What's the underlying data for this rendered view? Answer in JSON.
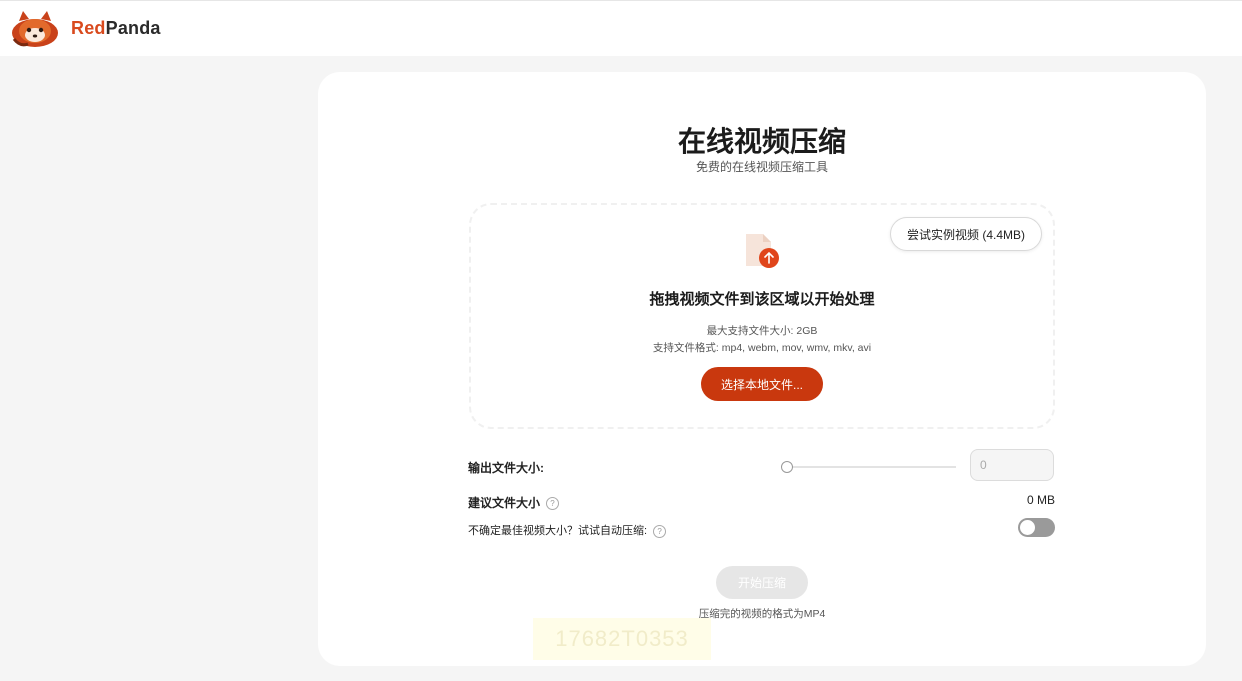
{
  "header": {
    "brand_part1": "Red",
    "brand_part2": "Panda",
    "brand_color": "#d94a1e",
    "logo_icon": "red-panda-logo-icon"
  },
  "main": {
    "title": "在线视频压缩",
    "subtitle": "免费的在线视频压缩工具",
    "try_sample_label": "尝试实例视频 (4.4MB)",
    "drop_title": "拖拽视频文件到该区域以开始处理",
    "max_size_text": "最大支持文件大小: 2GB",
    "formats_text": "支持文件格式: mp4, webm, mov, wmv, mkv, avi",
    "choose_file_label": "选择本地文件...",
    "upload_icon": "file-upload-icon",
    "accent_color": "#c9380e"
  },
  "settings": {
    "output_size_label": "输出文件大小:",
    "output_size_value": "0",
    "slider_value": 0,
    "suggest_label": "建议文件大小",
    "suggest_value": "0 MB",
    "auto_label": "不确定最佳视频大小？试试自动压缩:",
    "auto_enabled": false
  },
  "actions": {
    "start_label": "开始压缩",
    "footnote": "压缩完的视频的格式为MP4"
  },
  "watermark": "17682T0353"
}
